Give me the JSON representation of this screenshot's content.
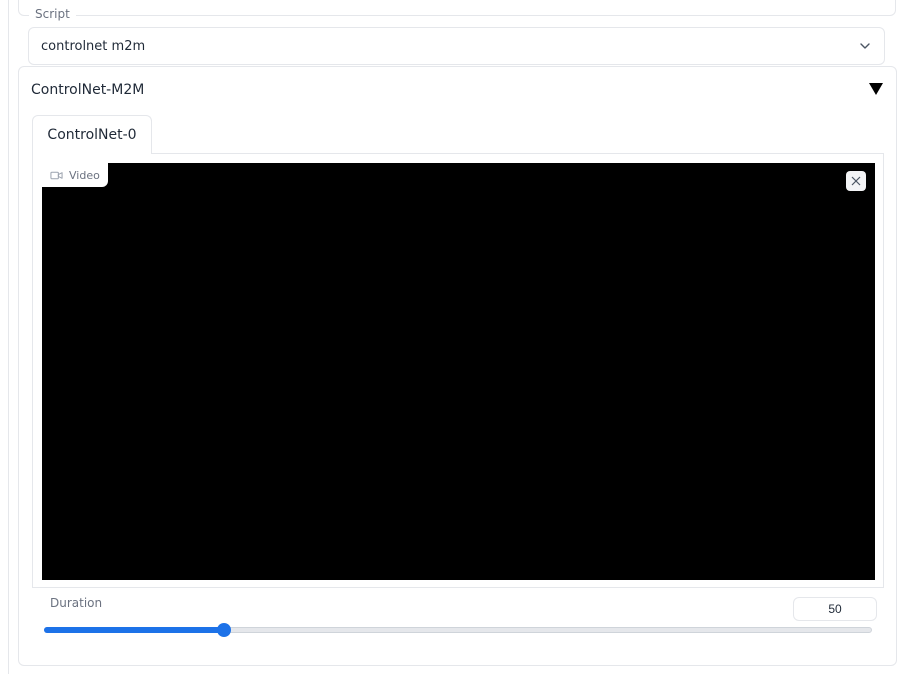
{
  "script": {
    "label": "Script",
    "selected": "controlnet m2m"
  },
  "accordion": {
    "title": "ControlNet-M2M",
    "expanded": true,
    "tabs": [
      {
        "label": "ControlNet-0",
        "active": true
      }
    ],
    "video": {
      "badge_label": "Video",
      "badge_icon": "video-camera-icon",
      "close_icon": "close-icon",
      "background": "#000000"
    },
    "duration": {
      "label": "Duration",
      "value": "50",
      "slider_fraction": 0.217
    }
  },
  "colors": {
    "accent": "#1d72e8",
    "border": "#e5e7eb",
    "muted_text": "#6b7280"
  }
}
